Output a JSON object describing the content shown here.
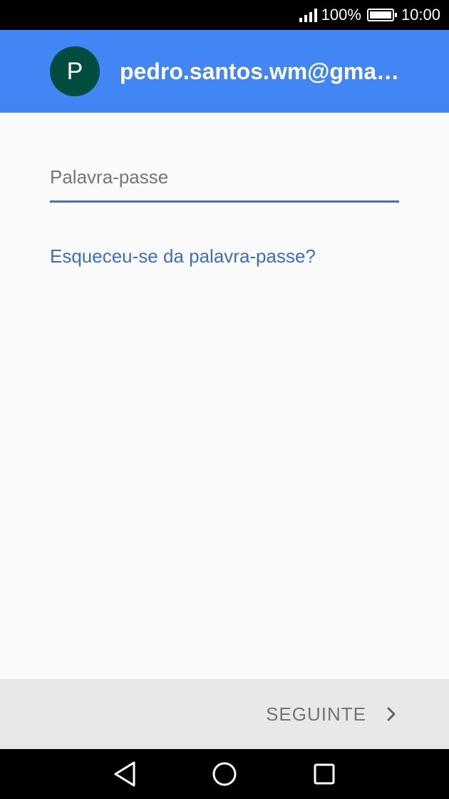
{
  "status_bar": {
    "battery_percent": "100%",
    "time": "10:00",
    "icons": [
      "signal-icon",
      "battery-icon"
    ]
  },
  "account": {
    "avatar_letter": "P",
    "email": "pedro.santos.wm@gmail.com"
  },
  "form": {
    "password_placeholder": "Palavra-passe",
    "password_value": "",
    "forgot_label": "Esqueceu-se da palavra-passe?"
  },
  "footer": {
    "next_label": "SEGUINTE",
    "next_icon": "chevron-right-icon"
  },
  "nav_bar": {
    "icons": [
      "back-icon",
      "home-icon",
      "recents-icon"
    ]
  },
  "colors": {
    "app_bar": "#4285f4",
    "avatar": "#004d40",
    "accent": "#3a6fd0",
    "link": "#3a6fc4",
    "footer": "#e6e8ea"
  }
}
